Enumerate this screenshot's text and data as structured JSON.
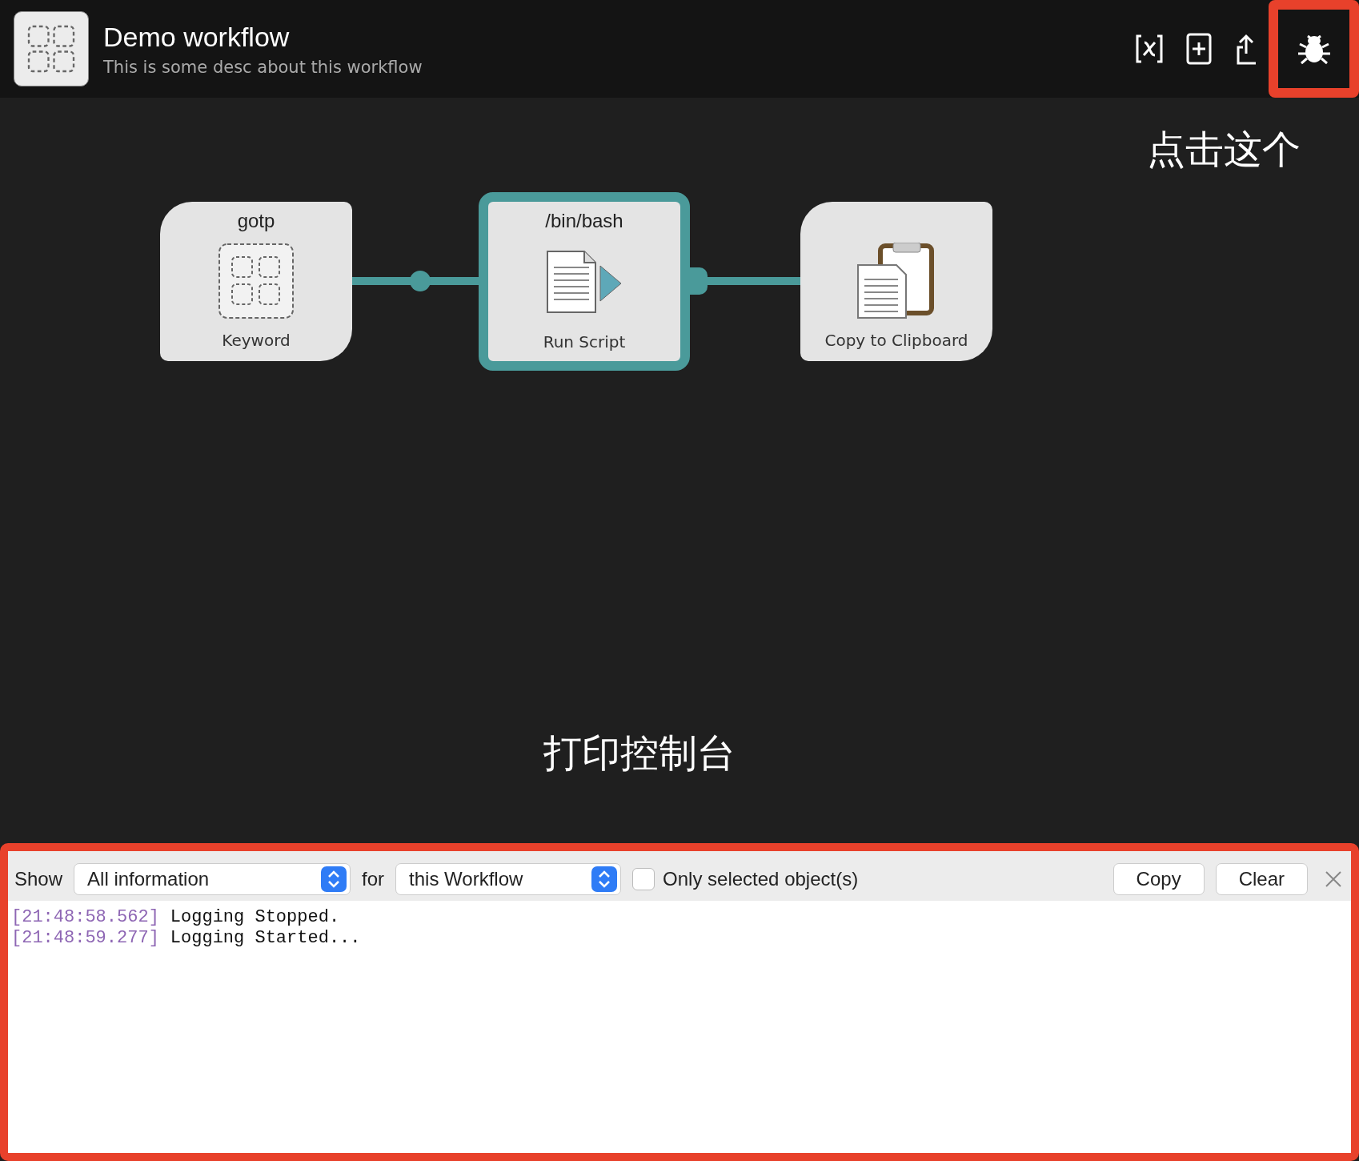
{
  "header": {
    "title": "Demo workflow",
    "description": "This is some desc about this workflow",
    "actions": [
      {
        "kind": "variables",
        "highlighted": false
      },
      {
        "kind": "add",
        "highlighted": false
      },
      {
        "kind": "export",
        "highlighted": false
      },
      {
        "kind": "debug",
        "highlighted": true
      }
    ]
  },
  "canvas": {
    "callout": "点击这个",
    "nodes": [
      {
        "kind": "keyword",
        "title": "gotp",
        "label": "Keyword",
        "selected": false
      },
      {
        "kind": "script",
        "title": "/bin/bash",
        "label": "Run Script",
        "selected": true
      },
      {
        "kind": "clipboard",
        "label": "Copy to Clipboard",
        "selected": false
      }
    ],
    "console_callout": "打印控制台"
  },
  "console": {
    "highlighted": true,
    "show_label": "Show",
    "show_value": "All information",
    "for_label": "for",
    "for_value": "this Workflow",
    "only_selected": {
      "label": "Only selected object(s)",
      "checked": false
    },
    "buttons": [
      "Copy",
      "Clear"
    ],
    "log": [
      {
        "time": "[21:48:58.562]",
        "message": "Logging Stopped."
      },
      {
        "time": "[21:48:59.277]",
        "message": "Logging Started..."
      }
    ]
  }
}
